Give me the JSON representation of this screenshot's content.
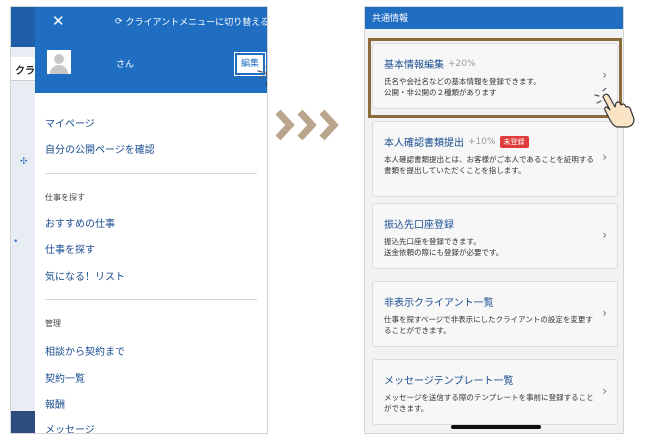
{
  "left": {
    "switch_menu_label": "クライアントメニューに切り替える",
    "user_name": "さん",
    "edit_label": "編集",
    "background_label": "クラ",
    "menu_items": [
      "マイページ",
      "自分の公開ページを確認"
    ],
    "section_work": "仕事を探す",
    "work_items": [
      "おすすめの仕事",
      "仕事を探す",
      "気になる！リスト"
    ],
    "section_manage": "管理",
    "manage_items": [
      "相談から契約まで",
      "契約一覧",
      "報酬",
      "メッセージ"
    ]
  },
  "right": {
    "header": "共通情報",
    "cards": [
      {
        "title": "基本情報編集",
        "bonus": "+20%",
        "badge": "",
        "desc": "氏名や会社名などの基本情報を登録できます。\n公開・非公開の２種類があります"
      },
      {
        "title": "本人確認書類提出",
        "bonus": "+10%",
        "badge": "未登録",
        "desc": "本人確認書類提出とは、お客様がご本人であることを証明する書類を提出していただくことを指します。"
      },
      {
        "title": "振込先口座登録",
        "bonus": "",
        "badge": "",
        "desc": "振込先口座を登録できます。\n送金依頼の際にも登録が必要です。"
      },
      {
        "title": "非表示クライアント一覧",
        "bonus": "",
        "badge": "",
        "desc": "仕事を探すページで非表示にしたクライアントの設定を変更することができます。"
      },
      {
        "title": "メッセージテンプレート一覧",
        "bonus": "",
        "badge": "",
        "desc": "メッセージを送信する際のテンプレートを事前に登録することができます。"
      }
    ]
  },
  "colors": {
    "brand_blue": "#1f6ec2",
    "arrow": "#b9a58c",
    "highlight": "#8b6a3e",
    "badge_red": "#e03b3b"
  }
}
